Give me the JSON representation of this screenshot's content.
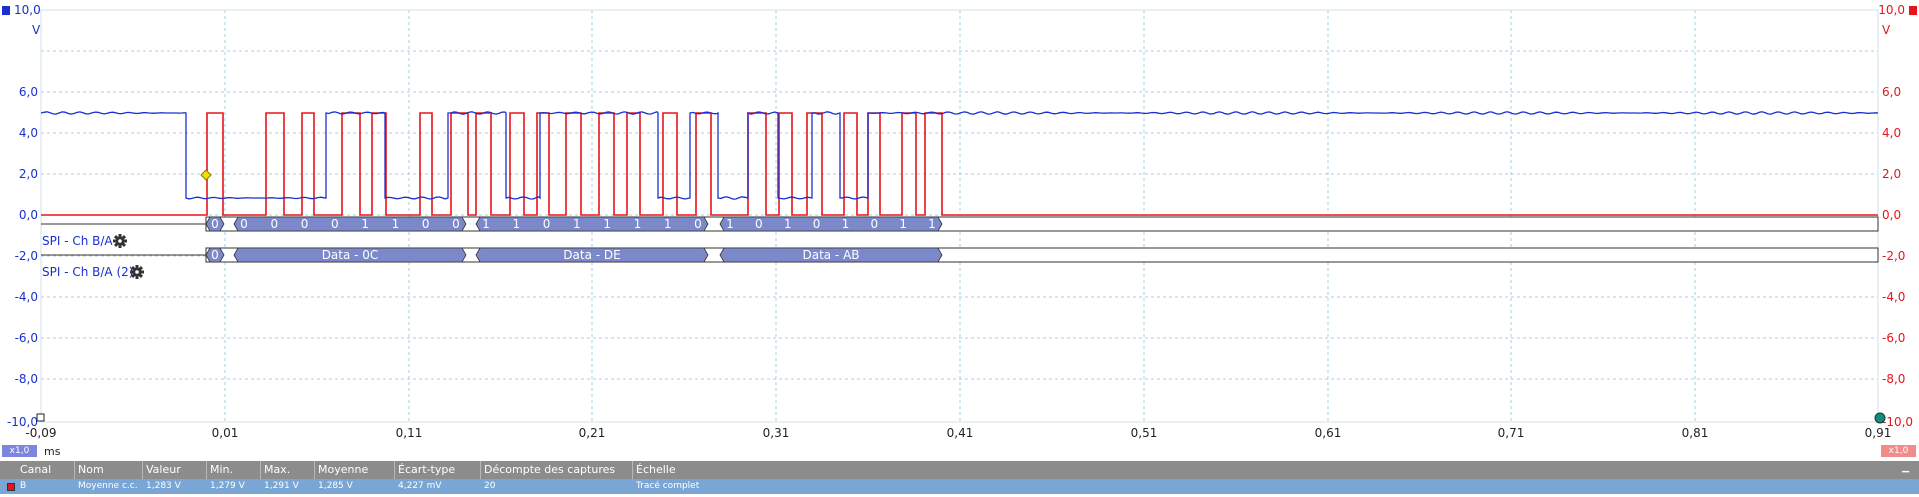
{
  "colors": {
    "channel_a": "#e8141b",
    "channel_b": "#1a2fd0",
    "grid": "#a8ccdc",
    "decode_fill": "#7b88c9",
    "marker": "#f0e000",
    "table_header": "#8c8c8c",
    "table_row": "#7aa6d6"
  },
  "left_axis": {
    "unit": "V",
    "ticks": [
      "10,0",
      "6,0",
      "4,0",
      "2,0",
      "0,0",
      "-2,0",
      "-4,0",
      "-6,0",
      "-8,0",
      "-10,0"
    ]
  },
  "right_axis": {
    "unit": "V",
    "ticks": [
      "10,0",
      "6,0",
      "4,0",
      "2,0",
      "0,0",
      "-2,0",
      "-4,0",
      "-6,0",
      "-8,0",
      "-10,0"
    ]
  },
  "time_axis": {
    "unit": "ms",
    "ticks": [
      "-0,09",
      "0,01",
      "0,11",
      "0,21",
      "0,31",
      "0,41",
      "0,51",
      "0,61",
      "0,71",
      "0,81",
      "0,91"
    ],
    "left_zoom": "x1,0",
    "right_zoom": "x1,0"
  },
  "decoders": [
    {
      "label": "SPI - Ch B/A",
      "icon": "gear-icon",
      "packets": [
        {
          "bits": [
            "0"
          ]
        },
        {
          "bits": [
            "0",
            "0",
            "0",
            "0",
            "1",
            "1",
            "0",
            "0"
          ]
        },
        {
          "bits": [
            "1",
            "1",
            "0",
            "1",
            "1",
            "1",
            "1",
            "0"
          ]
        },
        {
          "bits": [
            "1",
            "0",
            "1",
            "0",
            "1",
            "0",
            "1",
            "1"
          ]
        }
      ]
    },
    {
      "label": "SPI - Ch B/A (2)",
      "icon": "gear-icon",
      "packets": [
        {
          "text": "0"
        },
        {
          "text": "Data - 0C"
        },
        {
          "text": "Data - DE"
        },
        {
          "text": "Data - AB"
        }
      ]
    }
  ],
  "measurements": {
    "headers": [
      "Canal",
      "Nom",
      "Valeur",
      "Min.",
      "Max.",
      "Moyenne",
      "Écart-type",
      "Décompte des captures",
      "Échelle"
    ],
    "rows": [
      [
        "B",
        "Moyenne c.c.",
        "1,283 V",
        "1,279 V",
        "1,291 V",
        "1,285 V",
        "4,227 mV",
        "20",
        "Tracé complet"
      ]
    ]
  }
}
